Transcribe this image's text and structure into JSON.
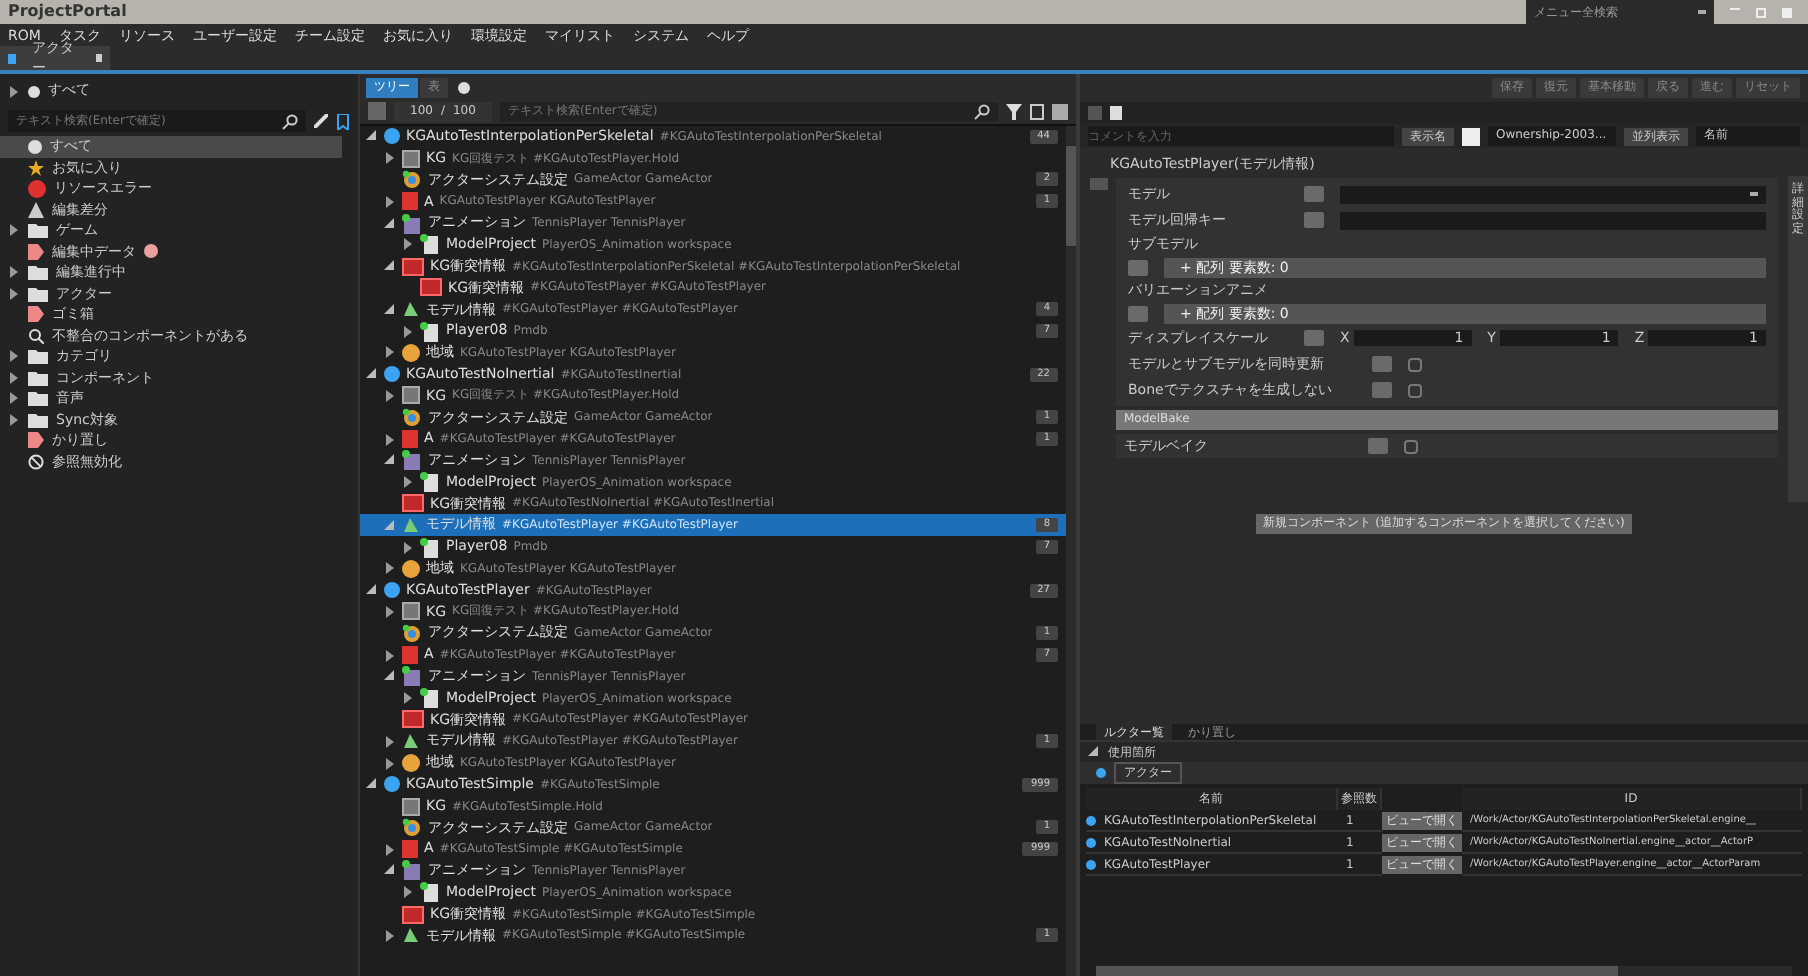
{
  "window": {
    "title": "ProjectPortal",
    "menu_search": {
      "placeholder": "メニュー全検索"
    }
  },
  "menu": [
    "ROM",
    "タスク",
    "リソース",
    "ユーザー設定",
    "チーム設定",
    "お気に入り",
    "環境設定",
    "マイリスト",
    "システム",
    "ヘルプ"
  ],
  "doc_tabs": [
    {
      "label": "アクター",
      "selected": true
    }
  ],
  "sidebar": {
    "root": "すべて",
    "search": {
      "placeholder": "テキスト検索(Enterで確定)"
    },
    "items": [
      {
        "label": "すべて",
        "kind": "dot",
        "selected": true
      },
      {
        "label": "お気に入り",
        "kind": "star",
        "selected": false
      },
      {
        "label": "リソースエラー",
        "kind": "error",
        "selected": false
      },
      {
        "label": "編集差分",
        "kind": "diff",
        "selected": false
      },
      {
        "label": "ゲーム",
        "kind": "folder",
        "expanded": false,
        "selected": false
      },
      {
        "label": "編集中データ",
        "kind": "tag",
        "badge": true,
        "selected": false
      },
      {
        "label": "編集進行中",
        "kind": "folder",
        "expanded": false,
        "selected": false
      },
      {
        "label": "アクター",
        "kind": "folder",
        "expanded": false,
        "selected": false
      },
      {
        "label": "ゴミ箱",
        "kind": "tag",
        "selected": false
      },
      {
        "label": "不整合のコンポーネントがある",
        "kind": "search",
        "selected": false
      },
      {
        "label": "カテゴリ",
        "kind": "folder",
        "expanded": false,
        "selected": false
      },
      {
        "label": "コンポーネント",
        "kind": "folder",
        "expanded": false,
        "selected": false
      },
      {
        "label": "音声",
        "kind": "folder",
        "expanded": false,
        "selected": false
      },
      {
        "label": "Sync対象",
        "kind": "folder",
        "expanded": false,
        "selected": false
      },
      {
        "label": "かり置し",
        "kind": "tag",
        "selected": false
      },
      {
        "label": "参照無効化",
        "kind": "ban",
        "selected": false
      }
    ]
  },
  "center": {
    "view_tabs": [
      {
        "label": "ツリー",
        "selected": true
      },
      {
        "label": "表",
        "selected": false
      }
    ],
    "counter": [
      "100",
      "/",
      "100"
    ],
    "search": {
      "placeholder": "テキスト検索(Enterで確定)"
    },
    "tree": [
      {
        "name": "KGAutoTestInterpolationPerSkeletal",
        "sub": "#KGAutoTestInterpolationPerSkeletal",
        "kind": "entity",
        "badge": "44",
        "expanded": true,
        "selected": false,
        "children": [
          {
            "name": "KG",
            "sub": "KG回復テスト #KGAutoTestPlayer.Hold",
            "kind": "graph",
            "expanded": false,
            "selected": false
          },
          {
            "name": "アクターシステム設定",
            "sub": "GameActor GameActor",
            "kind": "gear",
            "badge": "2",
            "selected": false
          },
          {
            "name": "A",
            "sub": "KGAutoTestPlayer KGAutoTestPlayer",
            "kind": "red",
            "badge": "1",
            "expanded": false,
            "selected": false
          },
          {
            "name": "アニメーション",
            "sub": "TennisPlayer TennisPlayer",
            "kind": "anim",
            "expanded": true,
            "selected": false,
            "children": [
              {
                "name": "ModelProject",
                "sub": "PlayerOS_Animation workspace",
                "kind": "file",
                "expanded": false,
                "selected": false
              }
            ]
          },
          {
            "name": "KG衝突情報",
            "sub": "#KGAutoTestInterpolationPerSkeletal #KGAutoTestInterpolationPerSkeletal",
            "kind": "collision",
            "expanded": true,
            "selected": false,
            "children": [
              {
                "name": "KG衝突情報",
                "sub": "#KGAutoTestPlayer #KGAutoTestPlayer",
                "kind": "collision",
                "selected": false
              }
            ]
          },
          {
            "name": "モデル情報",
            "sub": "#KGAutoTestPlayer #KGAutoTestPlayer",
            "kind": "model",
            "badge": "4",
            "expanded": true,
            "selected": false,
            "children": [
              {
                "name": "Player08",
                "sub": "Pmdb",
                "kind": "file",
                "badge": "7",
                "expanded": false,
                "selected": false
              }
            ]
          },
          {
            "name": "地域",
            "sub": "KGAutoTestPlayer KGAutoTestPlayer",
            "kind": "globe",
            "expanded": false,
            "selected": false
          }
        ]
      },
      {
        "name": "KGAutoTestNoInertial",
        "sub": "#KGAutoTestInertial",
        "kind": "entity",
        "badge": "22",
        "expanded": true,
        "selected": false,
        "children": [
          {
            "name": "KG",
            "sub": "KG回復テスト #KGAutoTestPlayer.Hold",
            "kind": "graph",
            "expanded": false,
            "selected": false
          },
          {
            "name": "アクターシステム設定",
            "sub": "GameActor GameActor",
            "kind": "gear",
            "badge": "1",
            "selected": false
          },
          {
            "name": "A",
            "sub": "#KGAutoTestPlayer #KGAutoTestPlayer",
            "kind": "red",
            "badge": "1",
            "expanded": false,
            "selected": false
          },
          {
            "name": "アニメーション",
            "sub": "TennisPlayer TennisPlayer",
            "kind": "anim",
            "expanded": true,
            "selected": false,
            "children": [
              {
                "name": "ModelProject",
                "sub": "PlayerOS_Animation workspace",
                "kind": "file",
                "expanded": false,
                "selected": false
              }
            ]
          },
          {
            "name": "KG衝突情報",
            "sub": "#KGAutoTestNoInertial #KGAutoTestInertial",
            "kind": "collision",
            "selected": false
          },
          {
            "name": "モデル情報",
            "sub": "#KGAutoTestPlayer #KGAutoTestPlayer",
            "kind": "model",
            "badge": "8",
            "expanded": true,
            "selected": true,
            "children": [
              {
                "name": "Player08",
                "sub": "Pmdb",
                "kind": "file",
                "badge": "7",
                "expanded": false,
                "selected": false
              }
            ]
          },
          {
            "name": "地域",
            "sub": "KGAutoTestPlayer KGAutoTestPlayer",
            "kind": "globe",
            "expanded": false,
            "selected": false
          }
        ]
      },
      {
        "name": "KGAutoTestPlayer",
        "sub": "#KGAutoTestPlayer",
        "kind": "entity",
        "badge": "27",
        "expanded": true,
        "selected": false,
        "children": [
          {
            "name": "KG",
            "sub": "KG回復テスト #KGAutoTestPlayer.Hold",
            "kind": "graph",
            "expanded": false,
            "selected": false
          },
          {
            "name": "アクターシステム設定",
            "sub": "GameActor GameActor",
            "kind": "gear",
            "badge": "1",
            "selected": false
          },
          {
            "name": "A",
            "sub": "#KGAutoTestPlayer #KGAutoTestPlayer",
            "kind": "red",
            "badge": "7",
            "expanded": false,
            "selected": false
          },
          {
            "name": "アニメーション",
            "sub": "TennisPlayer TennisPlayer",
            "kind": "anim",
            "expanded": true,
            "selected": false,
            "children": [
              {
                "name": "ModelProject",
                "sub": "PlayerOS_Animation workspace",
                "kind": "file",
                "expanded": false,
                "selected": false
              }
            ]
          },
          {
            "name": "KG衝突情報",
            "sub": "#KGAutoTestPlayer #KGAutoTestPlayer",
            "kind": "collision",
            "selected": false
          },
          {
            "name": "モデル情報",
            "sub": "#KGAutoTestPlayer #KGAutoTestPlayer",
            "kind": "model",
            "badge": "1",
            "expanded": false,
            "selected": false
          },
          {
            "name": "地域",
            "sub": "KGAutoTestPlayer KGAutoTestPlayer",
            "kind": "globe",
            "expanded": false,
            "selected": false
          }
        ]
      },
      {
        "name": "KGAutoTestSimple",
        "sub": "#KGAutoTestSimple",
        "kind": "entity",
        "badge": "999",
        "expanded": true,
        "selected": false,
        "children": [
          {
            "name": "KG",
            "sub": "#KGAutoTestSimple.Hold",
            "kind": "graph",
            "selected": false
          },
          {
            "name": "アクターシステム設定",
            "sub": "GameActor GameActor",
            "kind": "gear",
            "badge": "1",
            "selected": false
          },
          {
            "name": "A",
            "sub": "#KGAutoTestSimple #KGAutoTestSimple",
            "kind": "red",
            "badge": "999",
            "expanded": false,
            "selected": false
          },
          {
            "name": "アニメーション",
            "sub": "TennisPlayer TennisPlayer",
            "kind": "anim",
            "expanded": true,
            "selected": false,
            "children": [
              {
                "name": "ModelProject",
                "sub": "PlayerOS_Animation workspace",
                "kind": "file",
                "expanded": false,
                "selected": false
              }
            ]
          },
          {
            "name": "KG衝突情報",
            "sub": "#KGAutoTestSimple #KGAutoTestSimple",
            "kind": "collision",
            "selected": false
          },
          {
            "name": "モデル情報",
            "sub": "#KGAutoTestSimple #KGAutoTestSimple",
            "kind": "model",
            "badge": "1",
            "expanded": false,
            "selected": false
          }
        ]
      }
    ]
  },
  "right": {
    "actions": [
      "保存",
      "復元",
      "基本移動",
      "戻る",
      "進む",
      "リセット"
    ],
    "comment": {
      "placeholder": "コメントを入力"
    },
    "display_label": "表示名",
    "display_value": "Ownership-2003...",
    "sort_label": "並列表示",
    "sort_value": "名前",
    "section_title": "KGAutoTestPlayer(モデル情報)",
    "props": [
      {
        "label": "モデル",
        "kind": "dropdown"
      },
      {
        "label": "モデル回帰キー",
        "kind": "field"
      },
      {
        "label": "サブモデル",
        "kind": "array",
        "value": "+ 配列 要素数: 0"
      },
      {
        "label": "バリエーションアニメ",
        "kind": "array",
        "value": "+ 配列 要素数: 0"
      },
      {
        "label": "ディスプレイスケール",
        "kind": "vector",
        "axes": [
          {
            "axis": "X",
            "value": "1"
          },
          {
            "axis": "Y",
            "value": "1"
          },
          {
            "axis": "Z",
            "value": "1"
          }
        ]
      },
      {
        "label": "モデルとサブモデルを同時更新",
        "kind": "checkbox",
        "checked": false
      },
      {
        "label": "Boneでテクスチャを生成しない",
        "kind": "checkbox",
        "checked": false
      }
    ],
    "bake_title": "ModelBake",
    "bake_props": [
      {
        "label": "モデルベイク",
        "kind": "checkbox",
        "checked": false
      }
    ],
    "add_button": "新規コンポーネント (追加するコンポーネントを選択してください)",
    "side_tab": "詳細設定",
    "bottom_tabs": [
      {
        "label": "ルクター覧",
        "selected": true
      },
      {
        "label": "かり置し",
        "selected": false
      }
    ],
    "usage_title": "使用箇所",
    "filter_tag": "アクター",
    "table": {
      "columns": [
        "名前",
        "参照数",
        "ID"
      ],
      "rows": [
        {
          "name": "KGAutoTestInterpolationPerSkeletal",
          "count": "1",
          "action": "ビューで開く",
          "id": "/Work/Actor/KGAutoTestInterpolationPerSkeletal.engine__"
        },
        {
          "name": "KGAutoTestNoInertial",
          "count": "1",
          "action": "ビューで開く",
          "id": "/Work/Actor/KGAutoTestNoInertial.engine__actor__ActorP"
        },
        {
          "name": "KGAutoTestPlayer",
          "count": "1",
          "action": "ビューで開く",
          "id": "/Work/Actor/KGAutoTestPlayer.engine__actor__ActorParam"
        }
      ]
    }
  }
}
